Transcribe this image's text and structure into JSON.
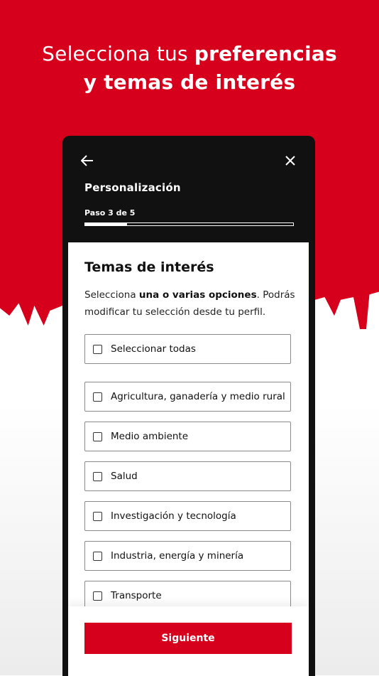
{
  "header": {
    "line1_regular": "Selecciona tus",
    "line1_bold": "preferencias",
    "line2_bold": "y temas de interés"
  },
  "modal": {
    "title": "Personalización",
    "step_label": "Paso 3 de 5",
    "progress": 0.2,
    "back_icon": "arrow-left-icon",
    "close_icon": "close-icon"
  },
  "content": {
    "title": "Temas de interés",
    "desc_prefix": "Selecciona ",
    "desc_bold": "una o varias opciones",
    "desc_suffix": ". Podrás modificar tu selección desde tu perfil.",
    "select_all": "Seleccionar todas",
    "options": [
      "Agricultura, ganadería y medio rural",
      "Medio ambiente",
      "Salud",
      "Investigación y tecnología",
      "Industria, energía y minería",
      "Transporte"
    ],
    "next_label": "Siguiente"
  },
  "colors": {
    "brand_red": "#d6001c",
    "dark": "#111111"
  }
}
